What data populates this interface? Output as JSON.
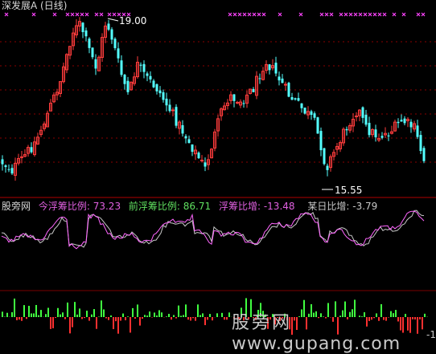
{
  "header": {
    "title": "深发展A",
    "period": "(日线)"
  },
  "price_annotations": {
    "high": "19.00",
    "low": "15.55"
  },
  "indicator": {
    "site_label": "股旁网",
    "fields": [
      {
        "name": "今浮筹比例:",
        "value": "73.23",
        "color": "#e060e0"
      },
      {
        "name": "前浮筹比例:",
        "value": "86.71",
        "color": "#60e060"
      },
      {
        "name": "浮筹比增:",
        "value": "-13.48",
        "color": "#e060e0"
      },
      {
        "name": "某日比增:",
        "value": "-3.79",
        "color": "#c8c8c8"
      }
    ]
  },
  "bottom_edge_value": "-1",
  "watermark": {
    "cn": "股旁网",
    "url": "www.gupang.com"
  },
  "colors": {
    "up": "#ff3c3c",
    "down": "#54ffff",
    "marker": "#ff44ff",
    "line_a": "#ff66ff",
    "line_b": "#c8c8c8",
    "bar_pos": "#40ff40",
    "bar_neg": "#ff3030",
    "grid": "#8a0000"
  }
}
